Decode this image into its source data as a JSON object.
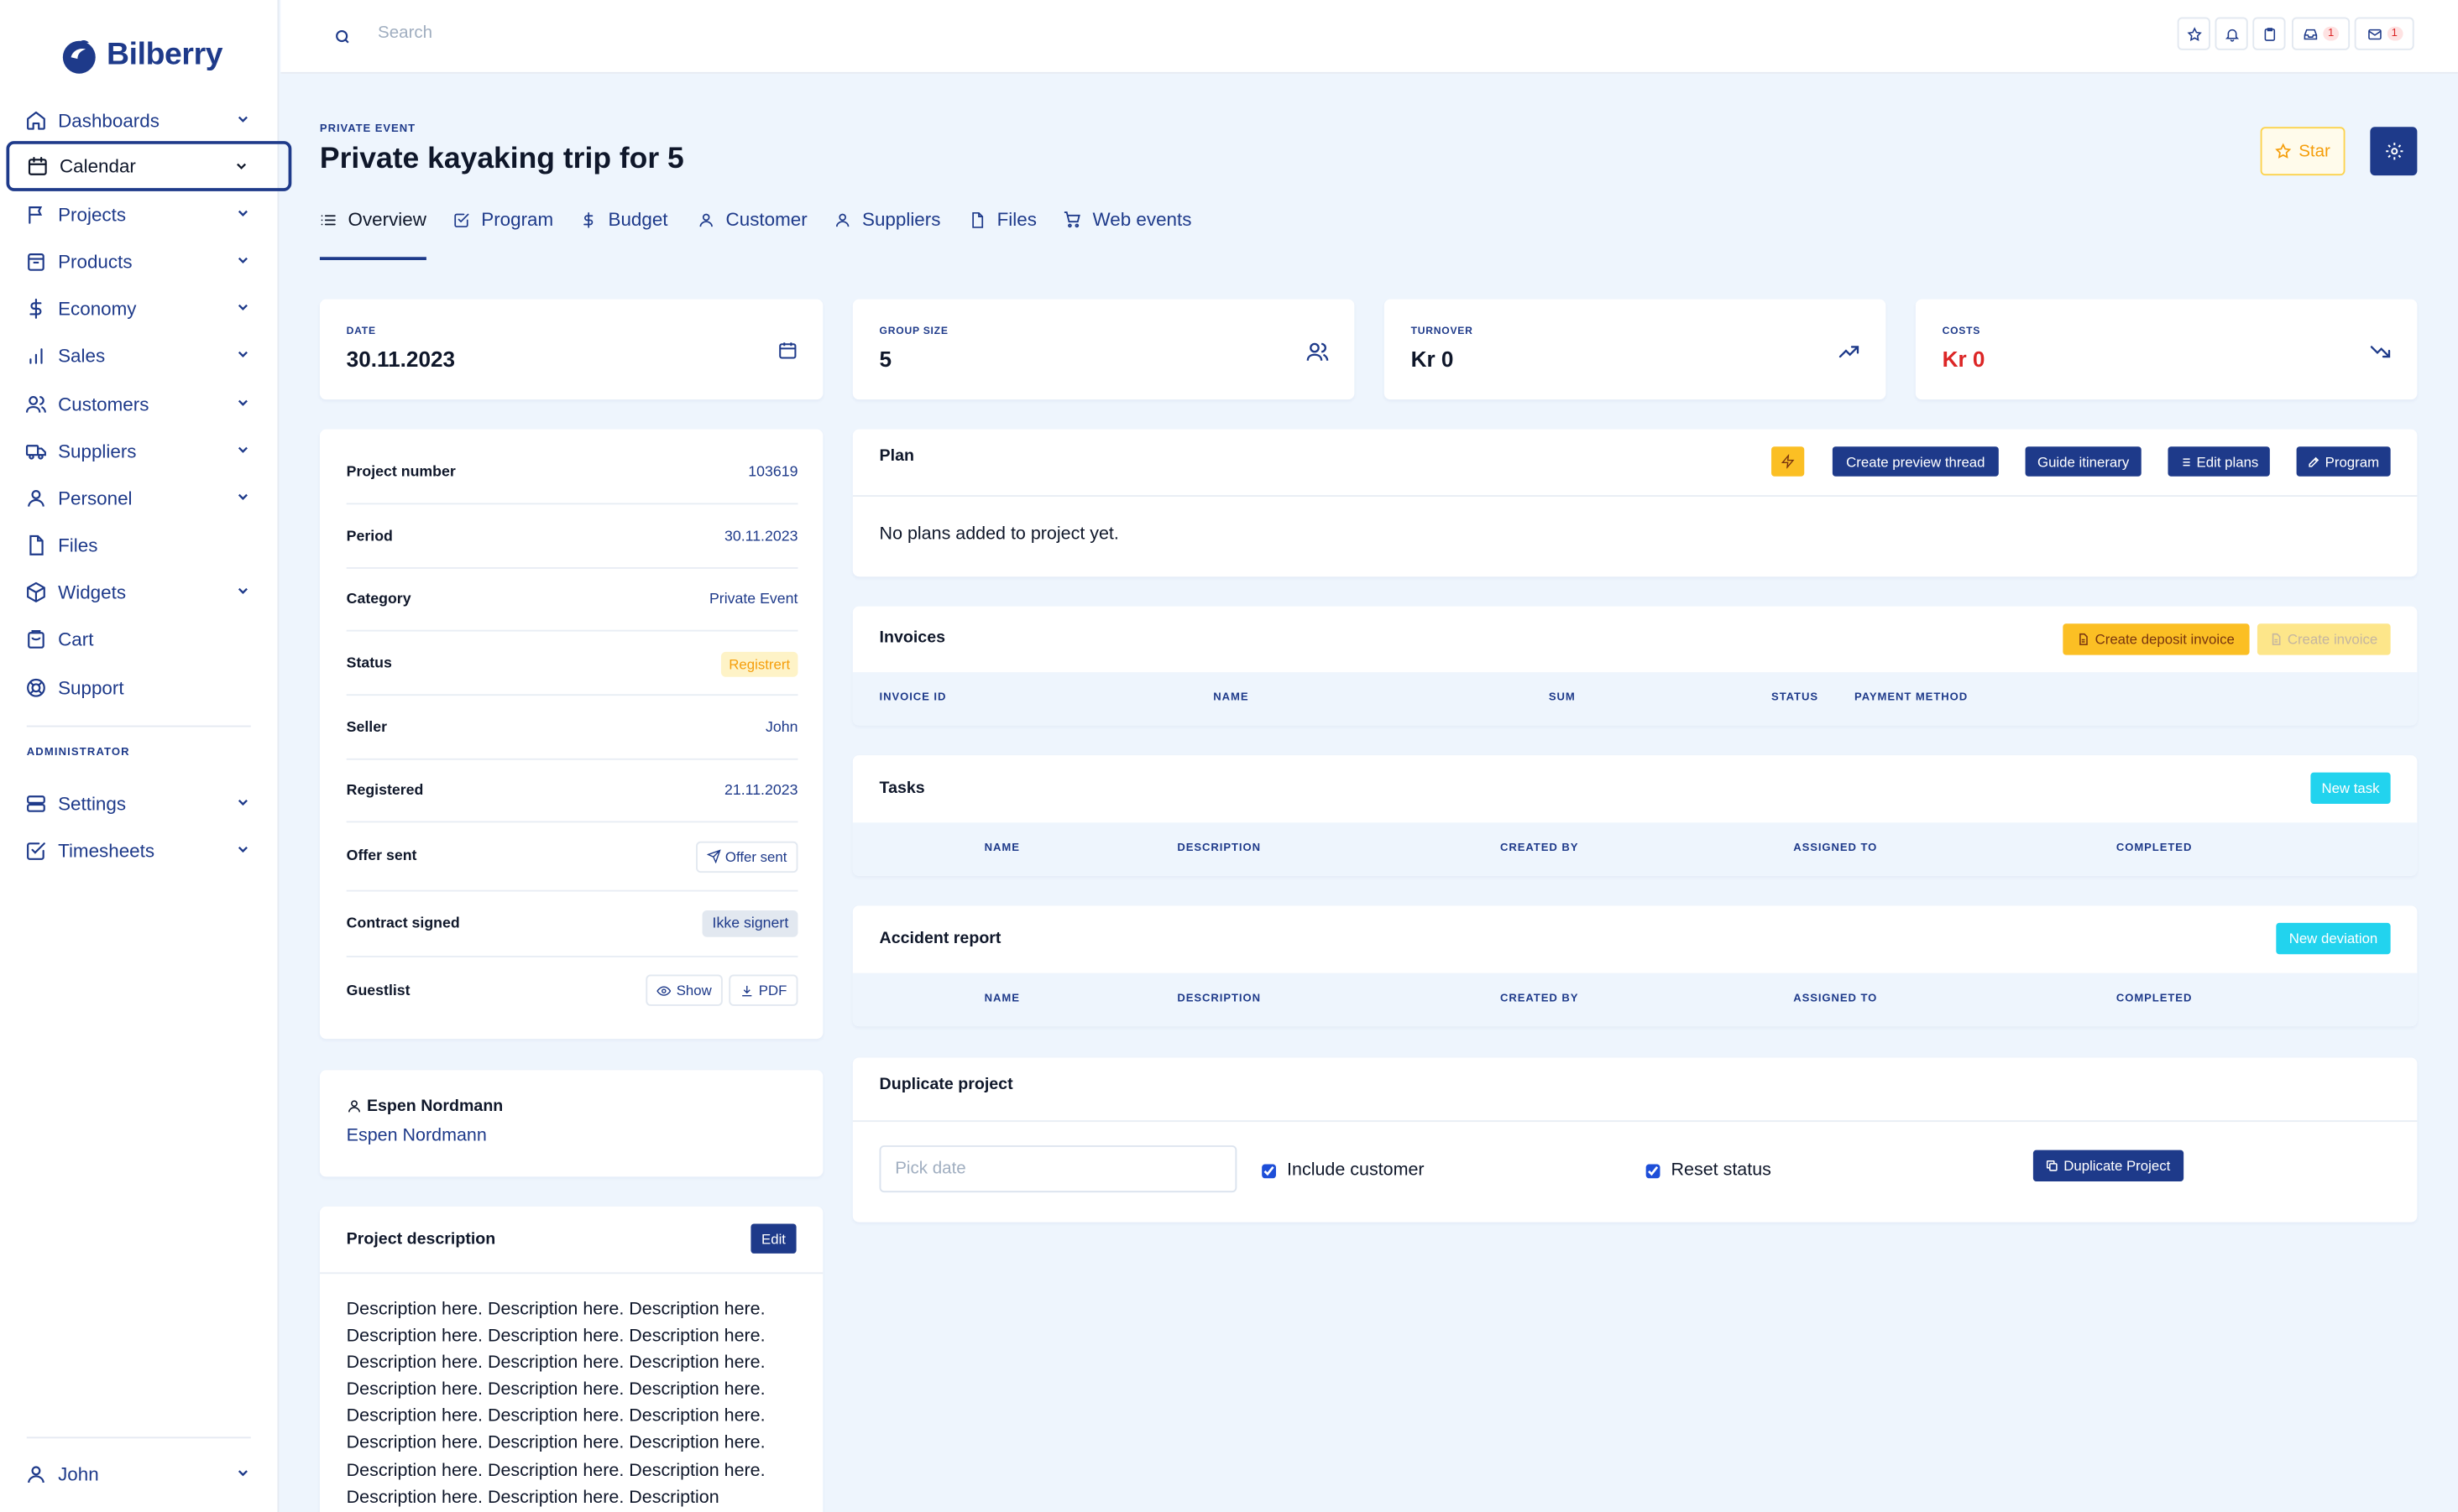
{
  "brand": {
    "name": "Bilberry"
  },
  "sidebar": {
    "items": [
      {
        "label": "Dashboards",
        "icon": "home-icon"
      },
      {
        "label": "Calendar",
        "icon": "calendar-icon"
      },
      {
        "label": "Projects",
        "icon": "flag-icon"
      },
      {
        "label": "Products",
        "icon": "box-icon"
      },
      {
        "label": "Economy",
        "icon": "dollar-icon"
      },
      {
        "label": "Sales",
        "icon": "bar-chart-icon"
      },
      {
        "label": "Customers",
        "icon": "users-icon"
      },
      {
        "label": "Suppliers",
        "icon": "truck-icon"
      },
      {
        "label": "Personel",
        "icon": "user-icon"
      },
      {
        "label": "Files",
        "icon": "file-icon"
      },
      {
        "label": "Widgets",
        "icon": "cube-icon"
      },
      {
        "label": "Cart",
        "icon": "cart-icon"
      },
      {
        "label": "Support",
        "icon": "lifebuoy-icon"
      }
    ],
    "admin_label": "ADMINISTRATOR",
    "admin_items": [
      {
        "label": "Settings",
        "icon": "server-icon"
      },
      {
        "label": "Timesheets",
        "icon": "checkbox-icon"
      }
    ],
    "user": {
      "label": "John"
    }
  },
  "topbar": {
    "search_placeholder": "Search",
    "badges": {
      "inbox": "1",
      "mail": "1"
    }
  },
  "header": {
    "event_type": "PRIVATE EVENT",
    "title": "Private kayaking trip for 5",
    "star_label": "Star"
  },
  "tabs": [
    {
      "label": "Overview"
    },
    {
      "label": "Program"
    },
    {
      "label": "Budget"
    },
    {
      "label": "Customer"
    },
    {
      "label": "Suppliers"
    },
    {
      "label": "Files"
    },
    {
      "label": "Web events"
    }
  ],
  "stats": {
    "date": {
      "label": "DATE",
      "value": "30.11.2023"
    },
    "group_size": {
      "label": "GROUP SIZE",
      "value": "5"
    },
    "turnover": {
      "label": "TURNOVER",
      "value": "Kr 0"
    },
    "costs": {
      "label": "COSTS",
      "value": "Kr 0",
      "color": "#dc2626"
    }
  },
  "properties": {
    "project_number": {
      "label": "Project number",
      "value": "103619"
    },
    "period": {
      "label": "Period",
      "value": "30.11.2023"
    },
    "category": {
      "label": "Category",
      "value": "Private Event"
    },
    "status": {
      "label": "Status",
      "value": "Registrert"
    },
    "seller": {
      "label": "Seller",
      "value": "John"
    },
    "registered": {
      "label": "Registered",
      "value": "21.11.2023"
    },
    "offer_sent": {
      "label": "Offer sent",
      "value": "Offer sent"
    },
    "contract": {
      "label": "Contract signed",
      "value": "Ikke signert"
    },
    "guestlist": {
      "label": "Guestlist",
      "show": "Show",
      "pdf": "PDF"
    }
  },
  "customer": {
    "heading": "Espen Nordmann",
    "link": "Espen Nordmann"
  },
  "description": {
    "title": "Project description",
    "edit": "Edit",
    "text": "Description here. Description here. Description here. Description here. Description here. Description here. Description here. Description here. Description here. Description here. Description here. Description here. Description here. Description here. Description here. Description here. Description here. Description here. Description here. Description here. Description here. Description here. Description here. Description"
  },
  "plan": {
    "title": "Plan",
    "buttons": {
      "preview": "Create preview thread",
      "guide": "Guide itinerary",
      "edit": "Edit plans",
      "program": "Program"
    },
    "empty": "No plans added to project yet."
  },
  "invoices": {
    "title": "Invoices",
    "deposit": "Create deposit invoice",
    "create": "Create invoice",
    "columns": [
      "INVOICE ID",
      "NAME",
      "SUM",
      "STATUS",
      "PAYMENT METHOD"
    ]
  },
  "tasks": {
    "title": "Tasks",
    "new": "New task",
    "columns": [
      "NAME",
      "DESCRIPTION",
      "CREATED BY",
      "ASSIGNED TO",
      "COMPLETED"
    ]
  },
  "accident": {
    "title": "Accident report",
    "new": "New deviation",
    "columns": [
      "NAME",
      "DESCRIPTION",
      "CREATED BY",
      "ASSIGNED TO",
      "COMPLETED"
    ]
  },
  "duplicate": {
    "title": "Duplicate project",
    "date_placeholder": "Pick date",
    "include_customer": "Include customer",
    "reset_status": "Reset status",
    "button": "Duplicate Project"
  }
}
